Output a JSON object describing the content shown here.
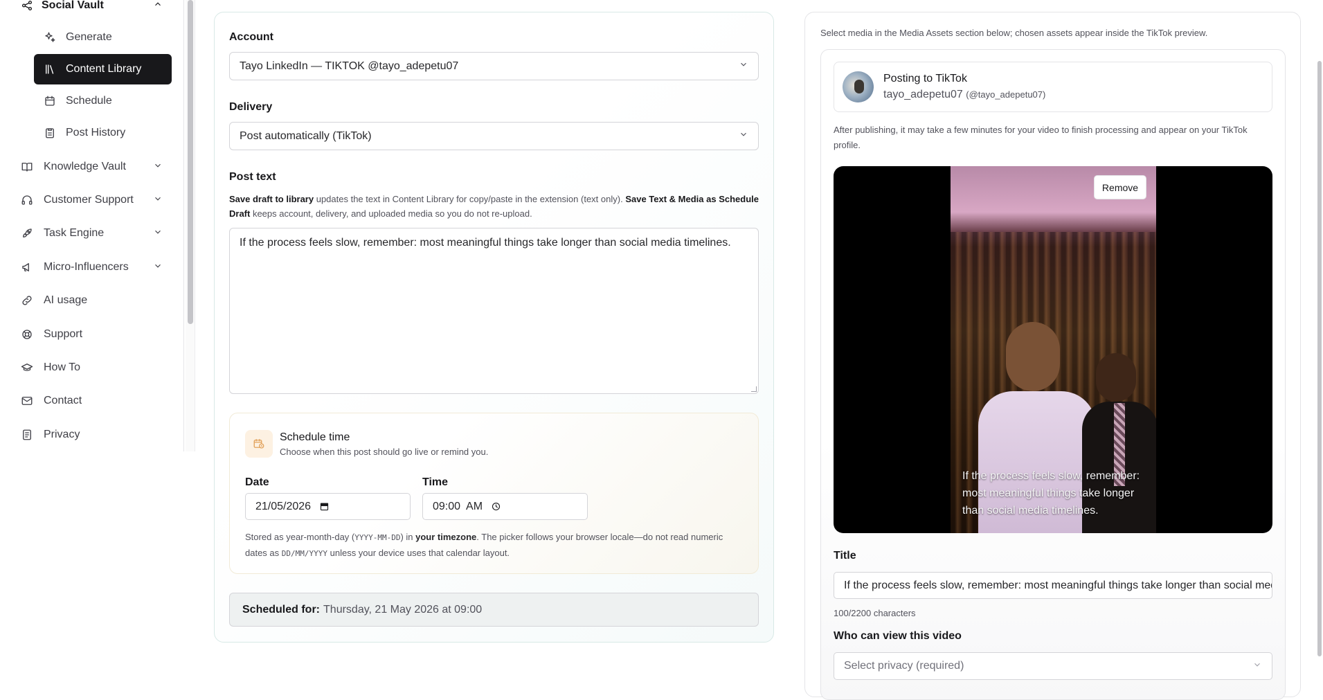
{
  "sidebar": {
    "section_title": "Social Vault",
    "sub_items": [
      {
        "label": "Generate",
        "icon": "sparkles-icon"
      },
      {
        "label": "Content Library",
        "icon": "library-icon",
        "active": true
      },
      {
        "label": "Schedule",
        "icon": "calendar-icon"
      },
      {
        "label": "Post History",
        "icon": "clipboard-icon"
      }
    ],
    "items": [
      {
        "label": "Knowledge Vault",
        "icon": "book-icon",
        "expandable": true
      },
      {
        "label": "Customer Support",
        "icon": "headphones-icon",
        "expandable": true
      },
      {
        "label": "Task Engine",
        "icon": "rocket-icon",
        "expandable": true
      },
      {
        "label": "Micro-Influencers",
        "icon": "megaphone-icon",
        "expandable": true
      },
      {
        "label": "AI usage",
        "icon": "link-icon",
        "expandable": false
      },
      {
        "label": "Support",
        "icon": "lifebuoy-icon",
        "expandable": false
      },
      {
        "label": "How To",
        "icon": "graduation-cap-icon",
        "expandable": false
      },
      {
        "label": "Contact",
        "icon": "mail-icon",
        "expandable": false
      },
      {
        "label": "Privacy",
        "icon": "document-icon",
        "expandable": false
      }
    ]
  },
  "form": {
    "account_label": "Account",
    "account_value": "Tayo LinkedIn — TIKTOK @tayo_adepetu07",
    "delivery_label": "Delivery",
    "delivery_value": "Post automatically (TikTok)",
    "post_text_label": "Post text",
    "help_bold_1": "Save draft to library",
    "help_text_1": " updates the text in Content Library for copy/paste in the extension (text only). ",
    "help_bold_2": "Save Text & Media as Schedule Draft",
    "help_text_2": " keeps account, delivery, and uploaded media so you do not re-upload.",
    "post_text_value": "If the process feels slow, remember: most meaningful things take longer than social media timelines.",
    "schedule": {
      "title": "Schedule time",
      "subtitle": "Choose when this post should go live or remind you.",
      "date_label": "Date",
      "date_value": "21/05/2026",
      "time_label": "Time",
      "time_value": "09:00  AM",
      "note_1": "Stored as year-month-day (",
      "note_mono_1": "YYYY-MM-DD",
      "note_2": ") in ",
      "note_bold": "your timezone",
      "note_3": ". The picker follows your browser locale—do not read numeric dates as ",
      "note_mono_2": "DD/MM/YYYY",
      "note_4": " unless your device uses that calendar layout."
    },
    "scheduled_for_label": "Scheduled for:",
    "scheduled_for_value": "Thursday, 21 May 2026 at 09:00"
  },
  "preview": {
    "top_note": "Select media in the Media Assets section below; chosen assets appear inside the TikTok preview.",
    "posting_title": "Posting to TikTok",
    "posting_user": "tayo_adepetu07",
    "posting_handle": "(@tayo_adepetu07)",
    "publish_note": "After publishing, it may take a few minutes for your video to finish processing and appear on your TikTok profile.",
    "remove_label": "Remove",
    "caption": "If the process feels slow, remember: most meaningful things take longer than social media timelines.",
    "title_label": "Title",
    "title_value": "If the process feels slow, remember: most meaningful things take longer than social media timelines.",
    "char_count": "100/2200 characters",
    "who_label": "Who can view this video",
    "privacy_placeholder": "Select privacy (required)"
  },
  "colors": {
    "active_nav_bg": "#18181b",
    "card_border": "#d8e9e6",
    "schedule_icon_bg": "#fdf1e2"
  }
}
